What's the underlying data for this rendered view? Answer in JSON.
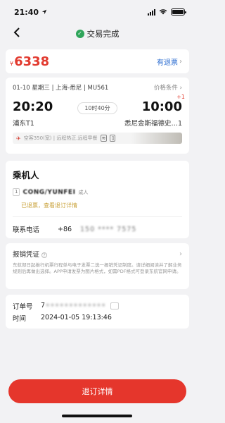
{
  "status_bar": {
    "time": "21:40",
    "location_icon": "location-arrow-icon"
  },
  "nav": {
    "title": "交易完成",
    "back_icon": "back-chevron-icon",
    "status_icon": "check-circle-icon"
  },
  "price": {
    "currency": "¥",
    "amount": "6338",
    "refund_link": "有退票"
  },
  "flight": {
    "meta": "01-10 星期三 | 上海-悉尼 | MU561",
    "conditions_label": "价格条件",
    "depart_time": "20:20",
    "arrive_time": "10:00",
    "day_offset": "+1",
    "duration": "10时40分",
    "depart_airport": "浦东T1",
    "arrive_airport": "悉尼金斯福德史…1",
    "amenity_text": "空客350(宽) | 远程热正,远程早餐"
  },
  "passenger": {
    "section_title": "乘机人",
    "index": "1",
    "name": "CONG/YUNFEI",
    "type": "成人",
    "refund_status": "已退票，查看退订详情",
    "phone_label": "联系电话",
    "phone_code": "+86",
    "phone_number": "150 **** 7575"
  },
  "invoice": {
    "title": "报销凭证",
    "note": "东航部日起推行机票行程单与电子发票二选一报销凭证制度。请详细阅读并了解业务规则后再做出选择。APP申请发票为图片格式，如需PDF格式可登录东航官网申请。"
  },
  "order": {
    "number_label": "订单号",
    "number_visible_prefix": "7",
    "number_masked": "•••••••••••••",
    "time_label": "时间",
    "time_value": "2024-01-05 19:13:46"
  },
  "bottom": {
    "button_label": "退订详情"
  },
  "colors": {
    "accent_red": "#e5362c",
    "link_blue": "#2d6ed1",
    "success_green": "#2fa55a",
    "status_gold": "#c9a23a"
  }
}
